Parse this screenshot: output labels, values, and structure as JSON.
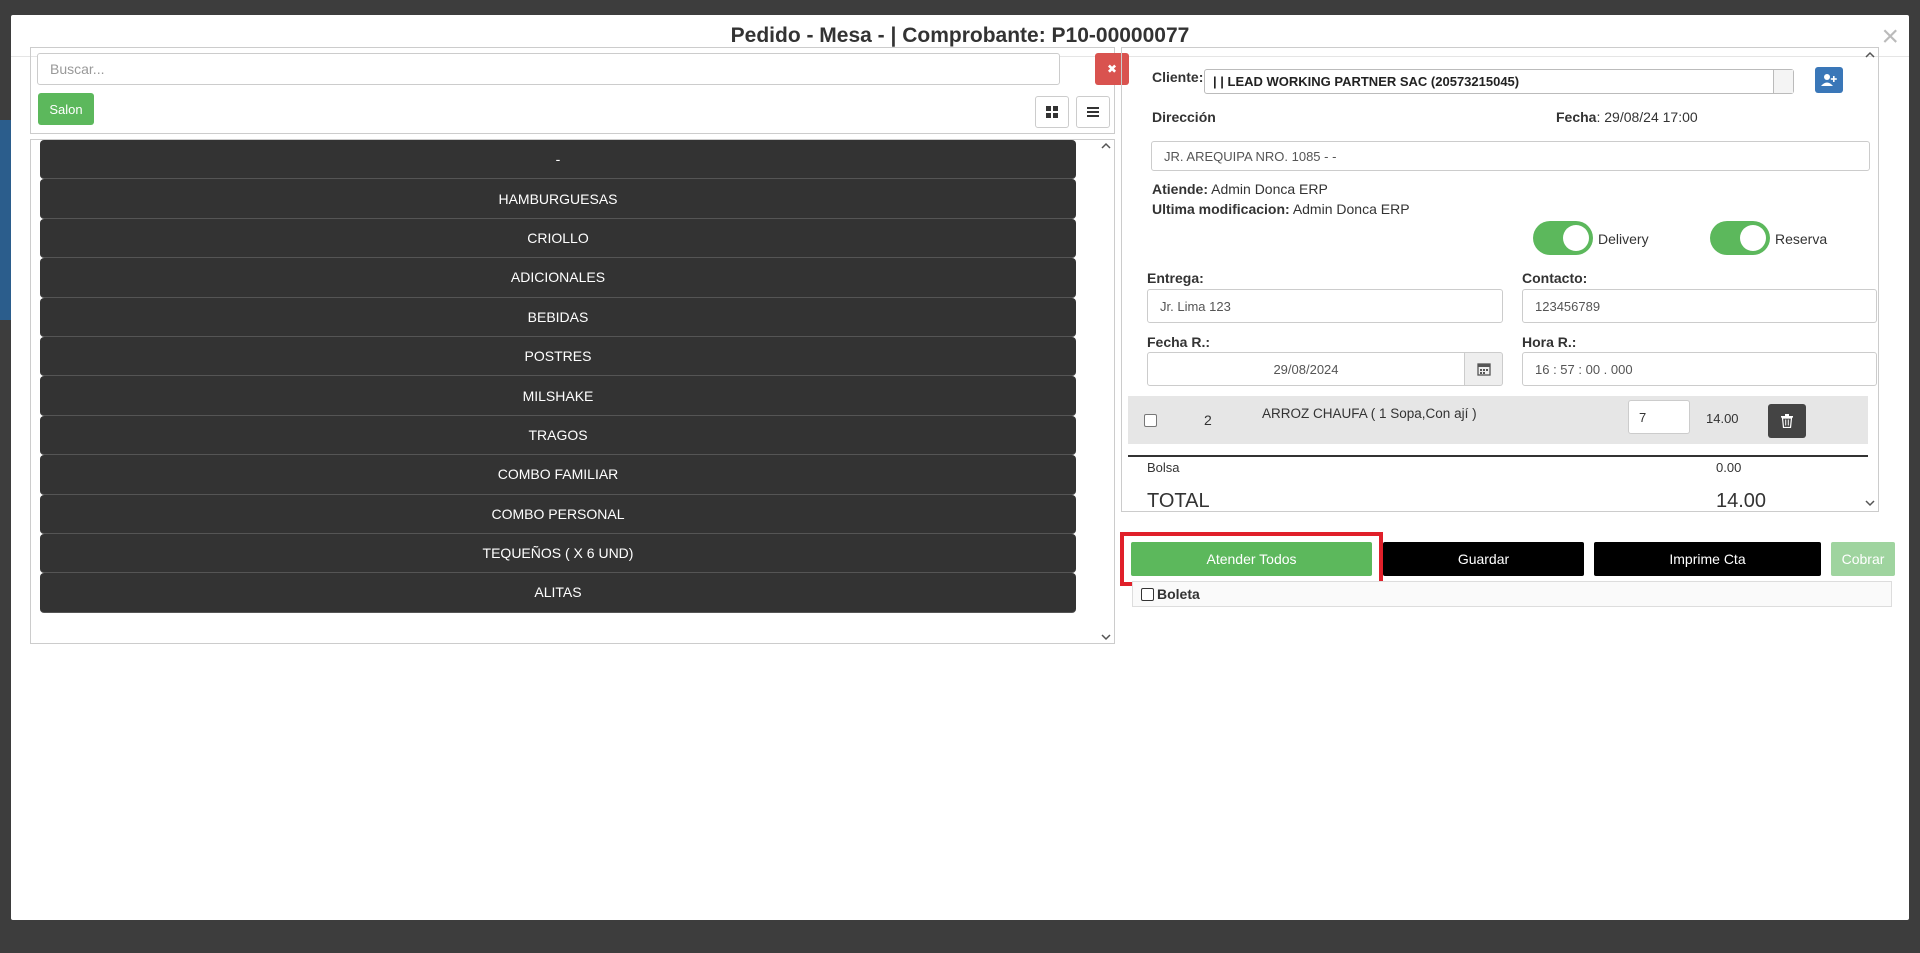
{
  "modal": {
    "title": "Pedido - Mesa - | Comprobante: P10-00000077",
    "close_symbol": "×"
  },
  "left": {
    "search_placeholder": "Buscar...",
    "clear_symbol": "✖",
    "salon_label": "Salon",
    "categories": [
      "-",
      "HAMBURGUESAS",
      "CRIOLLO",
      "ADICIONALES",
      "BEBIDAS",
      "POSTRES",
      "MILSHAKE",
      "TRAGOS",
      "COMBO FAMILIAR",
      "COMBO PERSONAL",
      "TEQUEÑOS ( X 6 UND)",
      "ALITAS"
    ]
  },
  "right": {
    "cliente_label": "Cliente",
    "cliente_value": "| | LEAD WORKING PARTNER SAC (20573215045)",
    "direccion_label": "Dirección",
    "fecha_label": "Fecha",
    "fecha_value": ": 29/08/24 17:00",
    "direccion_value": "JR. AREQUIPA NRO. 1085 - -",
    "atiende_label": "Atiende:",
    "atiende_value": "Admin Donca ERP",
    "ultima_label": "Ultima modificacion:",
    "ultima_value": "Admin Donca ERP",
    "delivery_label": "Delivery",
    "reserva_label": "Reserva",
    "entrega_label": "Entrega:",
    "entrega_value": "Jr. Lima 123",
    "contacto_label": "Contacto:",
    "contacto_value": "123456789",
    "fechar_label": "Fecha R.:",
    "fechar_value": "29/08/2024",
    "horar_label": "Hora R.:",
    "horar_value": "16 : 57 : 00 . 000",
    "order_item": {
      "num": "2",
      "name": "ARROZ CHAUFA ( 1 Sopa,Con ají )",
      "qty": "7",
      "price": "14.00"
    },
    "bolsa_label": "Bolsa",
    "bolsa_value": "0.00",
    "total_label": "TOTAL",
    "total_value": "14.00"
  },
  "actions": {
    "atender": "Atender Todos",
    "guardar": "Guardar",
    "imprime": "Imprime Cta",
    "cobrar": "Cobrar",
    "boleta": "Boleta"
  },
  "colors": {
    "green": "#5cb85c",
    "red": "#d9534f",
    "dark": "#333333",
    "highlight": "#e0202a"
  }
}
